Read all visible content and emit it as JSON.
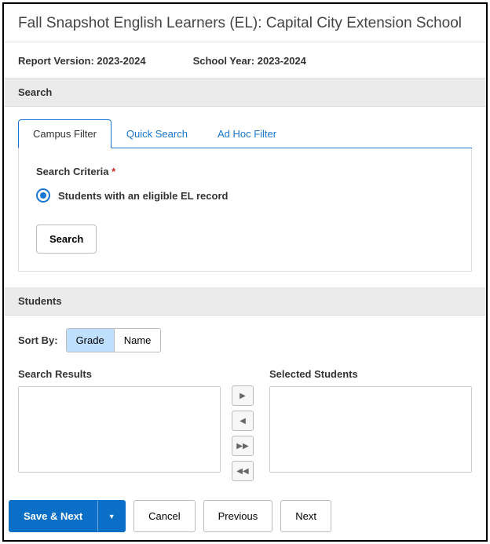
{
  "header": {
    "title": "Fall Snapshot English Learners (EL): Capital City Extension School"
  },
  "meta": {
    "report_version_label": "Report Version:",
    "report_version_value": "2023-2024",
    "school_year_label": "School Year:",
    "school_year_value": "2023-2024"
  },
  "search_section": {
    "header": "Search",
    "tabs": [
      {
        "label": "Campus Filter"
      },
      {
        "label": "Quick Search"
      },
      {
        "label": "Ad Hoc Filter"
      }
    ],
    "criteria_label": "Search Criteria",
    "required_marker": "*",
    "radio_option": "Students with an eligible EL record",
    "search_button": "Search"
  },
  "students_section": {
    "header": "Students",
    "sort_label": "Sort By:",
    "sort_options": [
      {
        "label": "Grade"
      },
      {
        "label": "Name"
      }
    ],
    "results_label": "Search Results",
    "selected_label": "Selected Students",
    "transfer_icons": {
      "add": "▶",
      "remove": "◀",
      "add_all": "▶▶",
      "remove_all": "◀◀"
    }
  },
  "footer": {
    "primary": "Save & Next",
    "dropdown_icon": "▼",
    "cancel": "Cancel",
    "previous": "Previous",
    "next": "Next"
  }
}
